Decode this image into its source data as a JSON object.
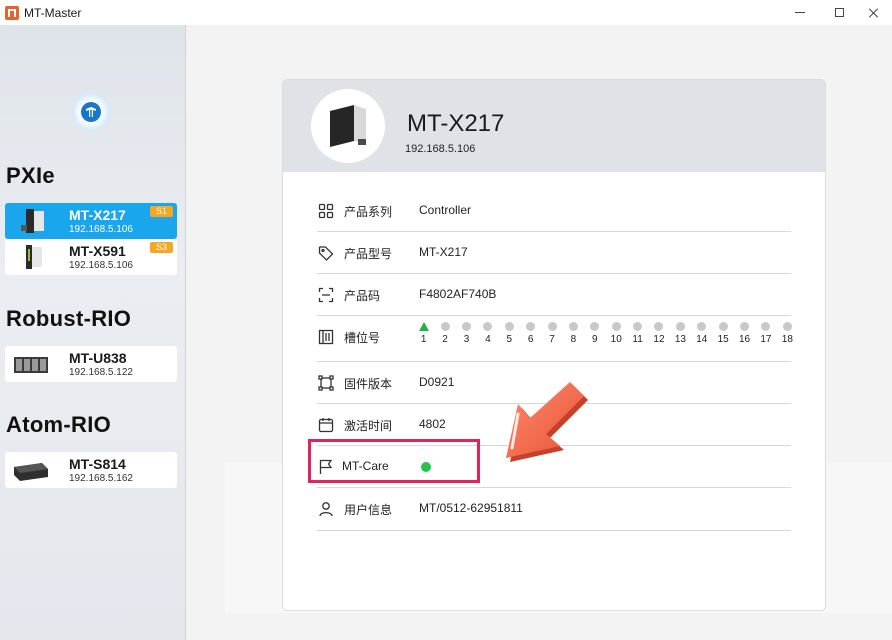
{
  "window": {
    "title": "MT-Master"
  },
  "sidebar": {
    "logo_letter": "M",
    "groups": [
      {
        "title": "PXIe",
        "devices": [
          {
            "name": "MT-X217",
            "ip": "192.168.5.106",
            "badge": "S1",
            "active": true
          },
          {
            "name": "MT-X591",
            "ip": "192.168.5.106",
            "badge": "S3",
            "active": false
          }
        ]
      },
      {
        "title": "Robust-RIO",
        "devices": [
          {
            "name": "MT-U838",
            "ip": "192.168.5.122"
          }
        ]
      },
      {
        "title": "Atom-RIO",
        "devices": [
          {
            "name": "MT-S814",
            "ip": "192.168.5.162"
          }
        ]
      }
    ]
  },
  "detail": {
    "name": "MT-X217",
    "ip": "192.168.5.106",
    "rows": {
      "series": {
        "label": "产品系列",
        "value": "Controller"
      },
      "model": {
        "label": "产品型号",
        "value": "MT-X217"
      },
      "code": {
        "label": "产品码",
        "value": "F4802AF740B"
      },
      "slot": {
        "label": "槽位号",
        "active_slot": 1,
        "slots": [
          "1",
          "2",
          "3",
          "4",
          "5",
          "6",
          "7",
          "8",
          "9",
          "10",
          "11",
          "12",
          "13",
          "14",
          "15",
          "16",
          "17",
          "18"
        ]
      },
      "firmware": {
        "label": "固件版本",
        "value": "D0921"
      },
      "activation": {
        "label": "激活时间",
        "value": "4802"
      },
      "care": {
        "label": "MT-Care",
        "status": "online"
      },
      "user": {
        "label": "用户信息",
        "value": "MT/0512-62951811"
      }
    }
  },
  "colors": {
    "accent": "#1aa6ec",
    "badge": "#f5a623",
    "status_green": "#27c24c",
    "highlight": "#e0245e",
    "arrow": "#f26a4b"
  }
}
